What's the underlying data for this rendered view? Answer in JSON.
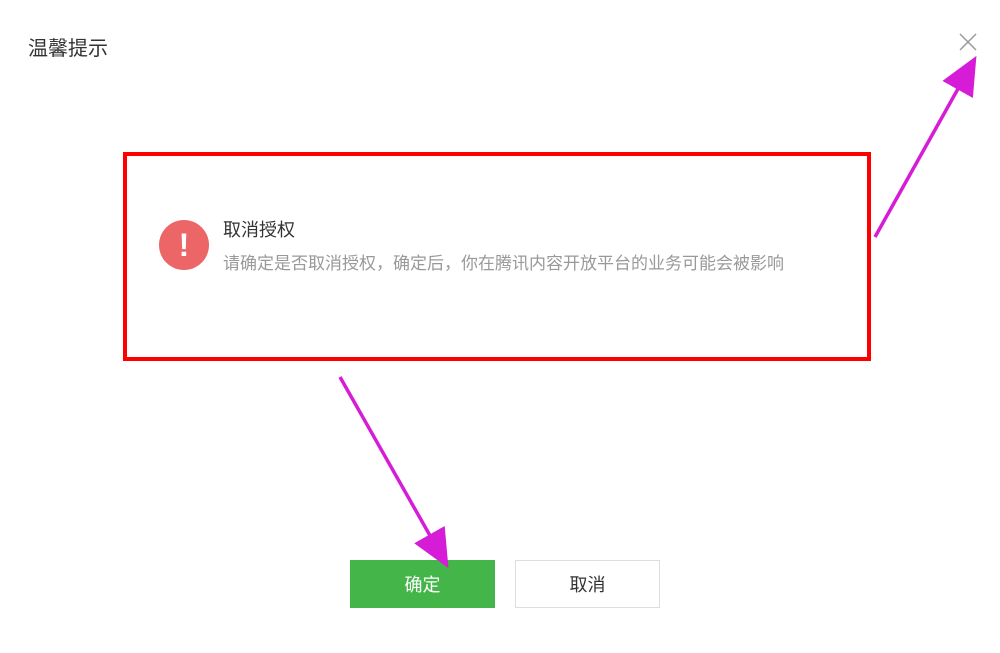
{
  "dialog": {
    "title": "温馨提示"
  },
  "alert": {
    "heading": "取消授权",
    "message": "请确定是否取消授权，确定后，你在腾讯内容开放平台的业务可能会被影响"
  },
  "buttons": {
    "confirm": "确定",
    "cancel": "取消"
  },
  "colors": {
    "accent_green": "#44b549",
    "alert_red": "#ec6567",
    "highlight_box": "#ff0000",
    "arrow_magenta": "#d61cd6"
  }
}
